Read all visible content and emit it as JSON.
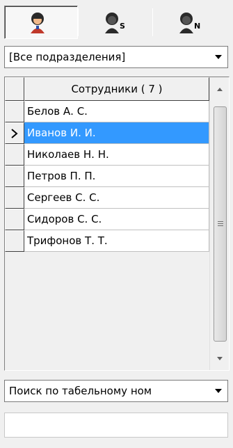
{
  "toolbar": {
    "buttons": [
      {
        "icon": "employee-icon",
        "subscript": "",
        "active": true
      },
      {
        "icon": "employee-s-icon",
        "subscript": "S",
        "active": false
      },
      {
        "icon": "employee-n-icon",
        "subscript": "N",
        "active": false
      }
    ]
  },
  "department_filter": {
    "value": "[Все подразделения]"
  },
  "employees_grid": {
    "header": "Сотрудники  ( 7 )",
    "rows": [
      {
        "name": "Белов А. С.",
        "selected": false
      },
      {
        "name": "Иванов И. И.",
        "selected": true
      },
      {
        "name": "Николаев Н. Н.",
        "selected": false
      },
      {
        "name": "Петров П. П.",
        "selected": false
      },
      {
        "name": "Сергеев С. С.",
        "selected": false
      },
      {
        "name": "Сидоров С. С.",
        "selected": false
      },
      {
        "name": "Трифонов Т. Т.",
        "selected": false
      }
    ]
  },
  "search_mode": {
    "value": "Поиск по табельному ном"
  },
  "search_field": {
    "value": ""
  },
  "colors": {
    "selection": "#3399ff",
    "background": "#f0f0f0"
  }
}
